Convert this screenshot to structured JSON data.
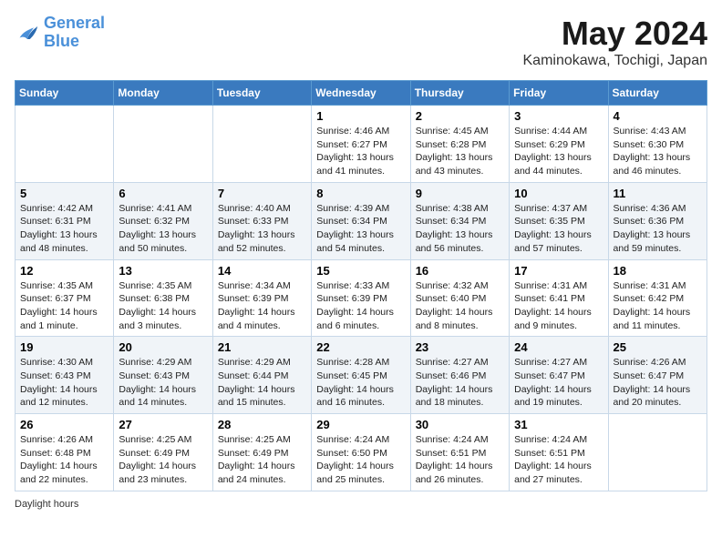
{
  "header": {
    "logo_general": "General",
    "logo_blue": "Blue",
    "month_title": "May 2024",
    "location": "Kaminokawa, Tochigi, Japan"
  },
  "days_of_week": [
    "Sunday",
    "Monday",
    "Tuesday",
    "Wednesday",
    "Thursday",
    "Friday",
    "Saturday"
  ],
  "weeks": [
    [
      {
        "day": "",
        "info": ""
      },
      {
        "day": "",
        "info": ""
      },
      {
        "day": "",
        "info": ""
      },
      {
        "day": "1",
        "info": "Sunrise: 4:46 AM\nSunset: 6:27 PM\nDaylight: 13 hours and 41 minutes."
      },
      {
        "day": "2",
        "info": "Sunrise: 4:45 AM\nSunset: 6:28 PM\nDaylight: 13 hours and 43 minutes."
      },
      {
        "day": "3",
        "info": "Sunrise: 4:44 AM\nSunset: 6:29 PM\nDaylight: 13 hours and 44 minutes."
      },
      {
        "day": "4",
        "info": "Sunrise: 4:43 AM\nSunset: 6:30 PM\nDaylight: 13 hours and 46 minutes."
      }
    ],
    [
      {
        "day": "5",
        "info": "Sunrise: 4:42 AM\nSunset: 6:31 PM\nDaylight: 13 hours and 48 minutes."
      },
      {
        "day": "6",
        "info": "Sunrise: 4:41 AM\nSunset: 6:32 PM\nDaylight: 13 hours and 50 minutes."
      },
      {
        "day": "7",
        "info": "Sunrise: 4:40 AM\nSunset: 6:33 PM\nDaylight: 13 hours and 52 minutes."
      },
      {
        "day": "8",
        "info": "Sunrise: 4:39 AM\nSunset: 6:34 PM\nDaylight: 13 hours and 54 minutes."
      },
      {
        "day": "9",
        "info": "Sunrise: 4:38 AM\nSunset: 6:34 PM\nDaylight: 13 hours and 56 minutes."
      },
      {
        "day": "10",
        "info": "Sunrise: 4:37 AM\nSunset: 6:35 PM\nDaylight: 13 hours and 57 minutes."
      },
      {
        "day": "11",
        "info": "Sunrise: 4:36 AM\nSunset: 6:36 PM\nDaylight: 13 hours and 59 minutes."
      }
    ],
    [
      {
        "day": "12",
        "info": "Sunrise: 4:35 AM\nSunset: 6:37 PM\nDaylight: 14 hours and 1 minute."
      },
      {
        "day": "13",
        "info": "Sunrise: 4:35 AM\nSunset: 6:38 PM\nDaylight: 14 hours and 3 minutes."
      },
      {
        "day": "14",
        "info": "Sunrise: 4:34 AM\nSunset: 6:39 PM\nDaylight: 14 hours and 4 minutes."
      },
      {
        "day": "15",
        "info": "Sunrise: 4:33 AM\nSunset: 6:39 PM\nDaylight: 14 hours and 6 minutes."
      },
      {
        "day": "16",
        "info": "Sunrise: 4:32 AM\nSunset: 6:40 PM\nDaylight: 14 hours and 8 minutes."
      },
      {
        "day": "17",
        "info": "Sunrise: 4:31 AM\nSunset: 6:41 PM\nDaylight: 14 hours and 9 minutes."
      },
      {
        "day": "18",
        "info": "Sunrise: 4:31 AM\nSunset: 6:42 PM\nDaylight: 14 hours and 11 minutes."
      }
    ],
    [
      {
        "day": "19",
        "info": "Sunrise: 4:30 AM\nSunset: 6:43 PM\nDaylight: 14 hours and 12 minutes."
      },
      {
        "day": "20",
        "info": "Sunrise: 4:29 AM\nSunset: 6:43 PM\nDaylight: 14 hours and 14 minutes."
      },
      {
        "day": "21",
        "info": "Sunrise: 4:29 AM\nSunset: 6:44 PM\nDaylight: 14 hours and 15 minutes."
      },
      {
        "day": "22",
        "info": "Sunrise: 4:28 AM\nSunset: 6:45 PM\nDaylight: 14 hours and 16 minutes."
      },
      {
        "day": "23",
        "info": "Sunrise: 4:27 AM\nSunset: 6:46 PM\nDaylight: 14 hours and 18 minutes."
      },
      {
        "day": "24",
        "info": "Sunrise: 4:27 AM\nSunset: 6:47 PM\nDaylight: 14 hours and 19 minutes."
      },
      {
        "day": "25",
        "info": "Sunrise: 4:26 AM\nSunset: 6:47 PM\nDaylight: 14 hours and 20 minutes."
      }
    ],
    [
      {
        "day": "26",
        "info": "Sunrise: 4:26 AM\nSunset: 6:48 PM\nDaylight: 14 hours and 22 minutes."
      },
      {
        "day": "27",
        "info": "Sunrise: 4:25 AM\nSunset: 6:49 PM\nDaylight: 14 hours and 23 minutes."
      },
      {
        "day": "28",
        "info": "Sunrise: 4:25 AM\nSunset: 6:49 PM\nDaylight: 14 hours and 24 minutes."
      },
      {
        "day": "29",
        "info": "Sunrise: 4:24 AM\nSunset: 6:50 PM\nDaylight: 14 hours and 25 minutes."
      },
      {
        "day": "30",
        "info": "Sunrise: 4:24 AM\nSunset: 6:51 PM\nDaylight: 14 hours and 26 minutes."
      },
      {
        "day": "31",
        "info": "Sunrise: 4:24 AM\nSunset: 6:51 PM\nDaylight: 14 hours and 27 minutes."
      },
      {
        "day": "",
        "info": ""
      }
    ]
  ],
  "footer": {
    "daylight_hours": "Daylight hours"
  }
}
